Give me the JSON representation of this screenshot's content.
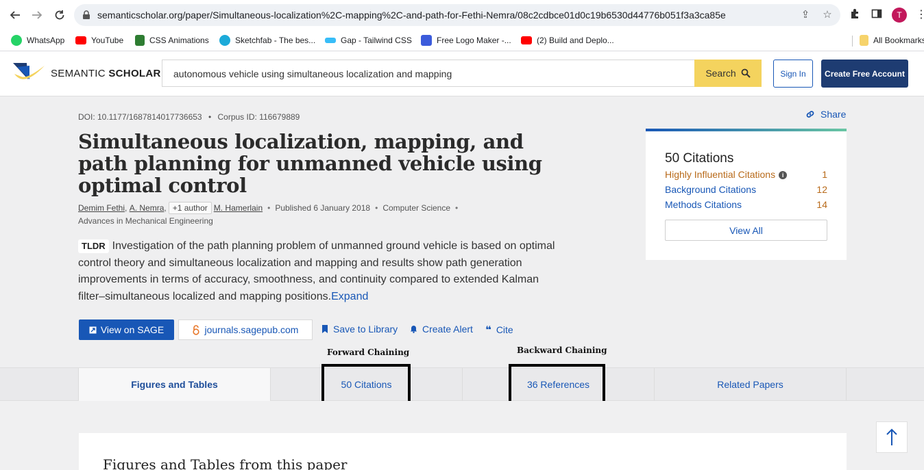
{
  "browser": {
    "url": "semanticscholar.org/paper/Simultaneous-localization%2C-mapping%2C-and-path-for-Fethi-Nemra/08c2cdbce01d0c19b6530d44776b051f3a3ca85e",
    "profile_initial": "T",
    "bookmarks": [
      {
        "label": "WhatsApp",
        "color": "#25d366"
      },
      {
        "label": "YouTube",
        "color": "#ff0000"
      },
      {
        "label": "CSS Animations",
        "color": "#2e7d32"
      },
      {
        "label": "Sketchfab - The bes...",
        "color": "#1caad9"
      },
      {
        "label": "Gap - Tailwind CSS",
        "color": "#38bdf8"
      },
      {
        "label": "Free Logo Maker -...",
        "color": "#3b5bdb"
      },
      {
        "label": "(2) Build and Deplo...",
        "color": "#ff0000"
      }
    ],
    "all_bookmarks": "All Bookmarks"
  },
  "header": {
    "logo_light": "SEMANTIC ",
    "logo_bold": "SCHOLAR",
    "search_value": "autonomous vehicle using simultaneous localization and mapping",
    "search_label": "Search",
    "signin_label": "Sign In",
    "create_label": "Create Free Account"
  },
  "paper": {
    "doi": "DOI: 10.1177/1687814017736653",
    "corpus": "Corpus ID: 116679889",
    "title": "Simultaneous localization, mapping, and path planning for unmanned vehicle using optimal control",
    "authors": [
      "Demim Fethi",
      "A. Nemra"
    ],
    "more_authors": "+1 author",
    "last_author": "M. Hamerlain",
    "published": "Published 6 January 2018",
    "field": "Computer Science",
    "venue": "Advances in Mechanical Engineering",
    "tldr_badge": "TLDR",
    "tldr_text": "Investigation of the path planning problem of unmanned ground vehicle is based on optimal control theory and simultaneous localization and mapping and results show path generation improvements in terms of accuracy, smoothness, and continuity compared to extended Kalman filter–simultaneous localized and mapping positions.",
    "expand": "Expand"
  },
  "actions": {
    "view_sage": "View on SAGE",
    "journal": "journals.sagepub.com",
    "save": "Save to Library",
    "alert": "Create Alert",
    "cite": "Cite",
    "share": "Share"
  },
  "citations_card": {
    "count": "50 Citations",
    "rows": [
      {
        "label": "Highly Influential Citations",
        "value": "1"
      },
      {
        "label": "Background Citations",
        "value": "12"
      },
      {
        "label": "Methods Citations",
        "value": "14"
      }
    ],
    "view_all": "View All"
  },
  "annotations": {
    "forward": "Forward Chaining",
    "backward": "Backward Chaining"
  },
  "tabs": [
    {
      "label": "Figures and Tables"
    },
    {
      "label": "50 Citations"
    },
    {
      "label": "36 References"
    },
    {
      "label": "Related Papers"
    }
  ],
  "figures_section": {
    "title": "Figures and Tables from this paper"
  }
}
